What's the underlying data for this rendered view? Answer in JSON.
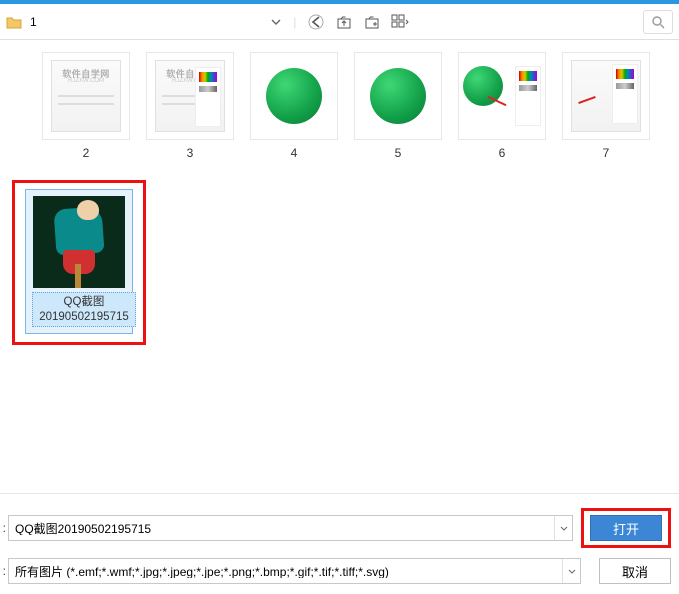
{
  "toolbar": {
    "path": "1",
    "watermark": "软件自学网",
    "watermark_sub": "RJZXW.COM"
  },
  "items": [
    {
      "name": "2",
      "kind": "panel"
    },
    {
      "name": "3",
      "kind": "panel"
    },
    {
      "name": "4",
      "kind": "sphere"
    },
    {
      "name": "5",
      "kind": "sphere"
    },
    {
      "name": "6",
      "kind": "sphere_panel"
    },
    {
      "name": "7",
      "kind": "color_panel"
    }
  ],
  "selected": {
    "line1": "QQ截图",
    "line2": "20190502195715"
  },
  "filename_input": "QQ截图20190502195715",
  "filter_input": "所有图片 (*.emf;*.wmf;*.jpg;*.jpeg;*.jpe;*.png;*.bmp;*.gif;*.tif;*.tiff;*.svg)",
  "buttons": {
    "open": "打开",
    "cancel": "取消"
  }
}
